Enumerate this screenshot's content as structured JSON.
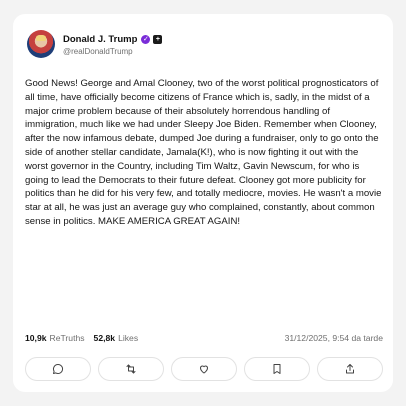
{
  "post": {
    "author": {
      "display_name": "Donald J. Trump",
      "handle": "@realDonaldTrump",
      "verified_icon": "check",
      "extra_icon": "plus"
    },
    "text": "Good News! George and Amal Clooney, two of the worst political prognosticators of all time, have officially become citizens of France which is, sadly, in the midst of a major crime problem because of their absolutely horrendous handling of immigration, much like we had under Sleepy Joe Biden. Remember when Clooney, after the now infamous debate, dumped Joe during a fundraiser, only to go onto the side of another stellar candidate, Jamala(K!), who is now fighting it out with the worst governor in the Country, including Tim Waltz, Gavin Newscum, for who is going to lead the Democrats to their future defeat. Clooney got more publicity for politics than he did for his very few, and totally mediocre, movies. He wasn't a movie star at all, he was just an average guy who complained, constantly, about common sense in politics. MAKE AMERICA GREAT AGAIN!",
    "stats": {
      "retruths_count": "10,9k",
      "retruths_label": "ReTruths",
      "likes_count": "52,8k",
      "likes_label": "Likes"
    },
    "timestamp": "31/12/2025, 9:54 da tarde"
  },
  "actions": {
    "icons": [
      "comment-icon",
      "retruth-icon",
      "like-icon",
      "bookmark-icon",
      "share-icon"
    ]
  },
  "colors": {
    "verified_badge": "#7a2cd8",
    "muted_text": "#6f6f6f",
    "background": "#f3f3f3"
  }
}
